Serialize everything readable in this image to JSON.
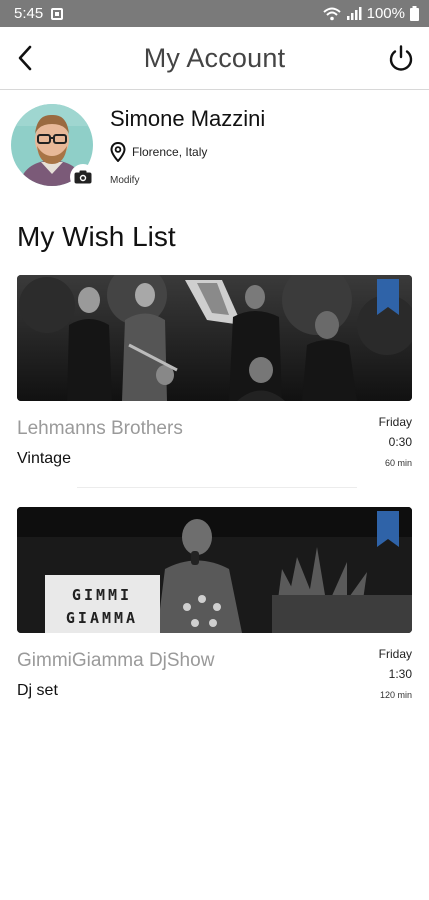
{
  "status_bar": {
    "time": "5:45",
    "battery": "100%",
    "icons": [
      "notification-box-icon",
      "wifi-icon",
      "signal-icon",
      "battery-icon"
    ]
  },
  "header": {
    "title": "My Account",
    "back_icon": "chevron-left-icon",
    "power_icon": "power-icon"
  },
  "profile": {
    "name": "Simone Mazzini",
    "location": "Florence, Italy",
    "modify_label": "Modify"
  },
  "wishlist": {
    "title": "My Wish List",
    "items": [
      {
        "name": "Lehmanns Brothers",
        "genre": "Vintage",
        "day": "Friday",
        "time": "0:30",
        "duration": "60 min"
      },
      {
        "name": "GimmiGiamma DjShow",
        "genre": "Dj set",
        "day": "Friday",
        "time": "1:30",
        "duration": "120 min",
        "sign_line1": "GIMMI",
        "sign_line2": "GIAMMA"
      }
    ]
  },
  "colors": {
    "status_bar": "#7a7a7a",
    "bookmark": "#2f63a8",
    "muted_text": "#9a9a9a"
  }
}
